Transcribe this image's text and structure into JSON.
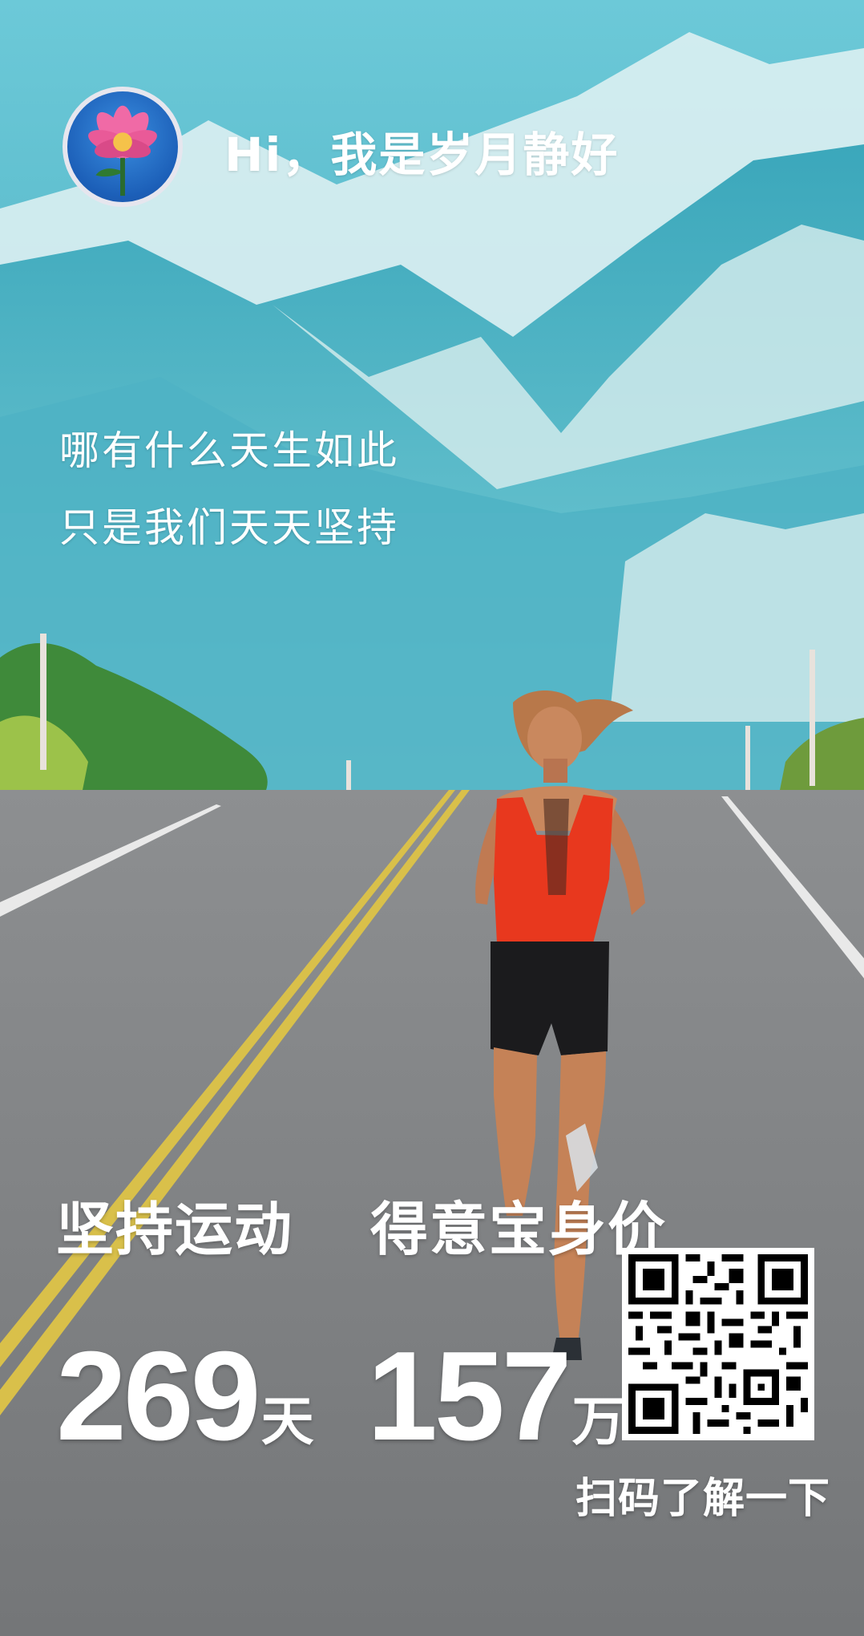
{
  "profile": {
    "greeting": "Hi，我是岁月静好"
  },
  "quote": {
    "line1": "哪有什么天生如此",
    "line2": "只是我们天天坚持"
  },
  "stats": [
    {
      "label": "坚持运动",
      "value": "269",
      "unit": "天"
    },
    {
      "label": "得意宝身价",
      "value": "157",
      "unit": "万"
    }
  ],
  "qr": {
    "caption": "扫码了解一下"
  },
  "icons": {
    "avatar": "pink-lotus-flower-icon",
    "qr": "qr-code-icon"
  },
  "colors": {
    "sky": "#5cc0cf",
    "road": "#808284",
    "text": "#ffffff",
    "runner_top": "#e8381e",
    "lane_line": "#d9c04a"
  }
}
